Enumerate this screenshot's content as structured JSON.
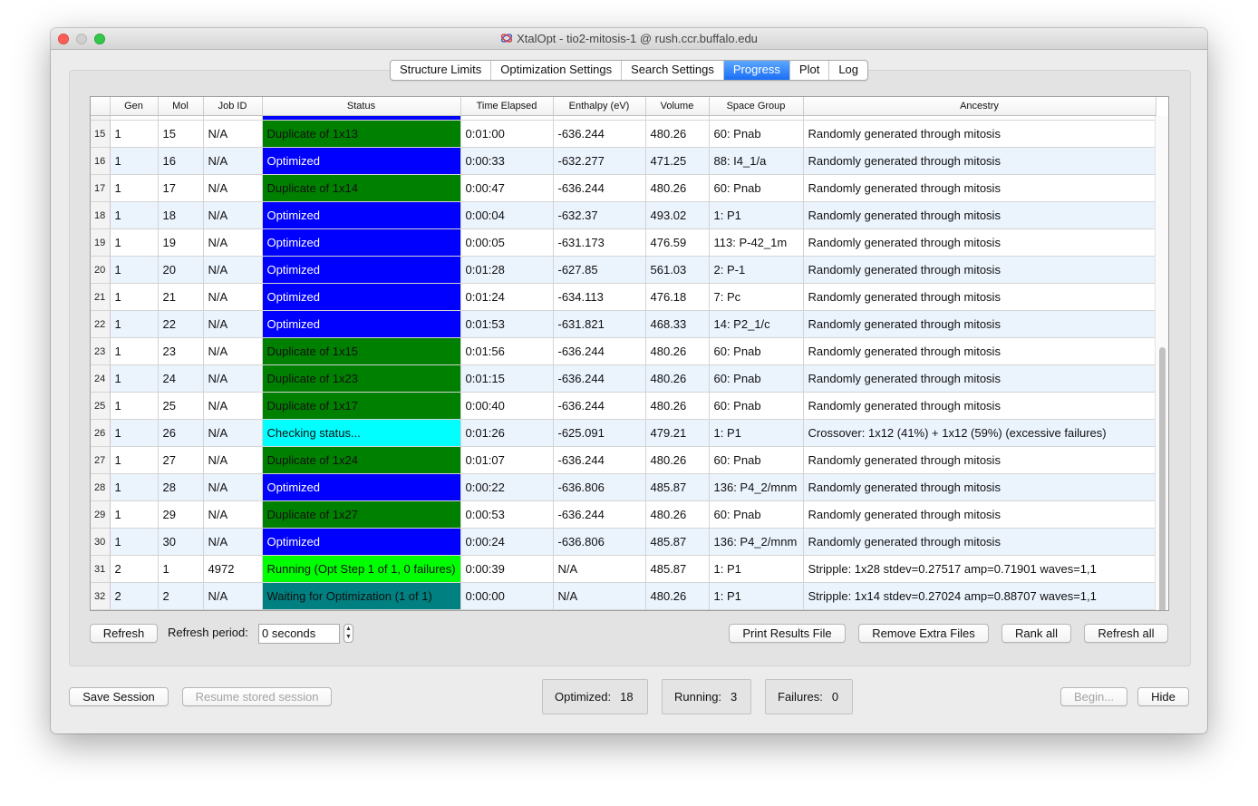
{
  "window": {
    "title": "XtalOpt - tio2-mitosis-1 @ rush.ccr.buffalo.edu"
  },
  "tabs": [
    "Structure Limits",
    "Optimization Settings",
    "Search Settings",
    "Progress",
    "Plot",
    "Log"
  ],
  "active_tab": "Progress",
  "table": {
    "columns": [
      "Gen",
      "Mol",
      "Job ID",
      "Status",
      "Time Elapsed",
      "Enthalpy (eV)",
      "Volume",
      "Space Group",
      "Ancestry"
    ],
    "status_colors": {
      "duplicate": "#008000",
      "optimized": "#0000ff",
      "checking": "#00ffff",
      "running": "#00ff00",
      "waiting": "#008080"
    },
    "rows": [
      {
        "row": "15",
        "gen": "1",
        "mol": "15",
        "job": "N/A",
        "status": "Duplicate of 1x13",
        "status_kind": "duplicate",
        "time": "0:01:00",
        "enthalpy": "-636.244",
        "volume": "480.26",
        "spacegroup": "60: Pnab",
        "ancestry": "Randomly generated through mitosis"
      },
      {
        "row": "16",
        "gen": "1",
        "mol": "16",
        "job": "N/A",
        "status": "Optimized",
        "status_kind": "optimized",
        "time": "0:00:33",
        "enthalpy": "-632.277",
        "volume": "471.25",
        "spacegroup": "88: I4_1/a",
        "ancestry": "Randomly generated through mitosis"
      },
      {
        "row": "17",
        "gen": "1",
        "mol": "17",
        "job": "N/A",
        "status": "Duplicate of 1x14",
        "status_kind": "duplicate",
        "time": "0:00:47",
        "enthalpy": "-636.244",
        "volume": "480.26",
        "spacegroup": "60: Pnab",
        "ancestry": "Randomly generated through mitosis"
      },
      {
        "row": "18",
        "gen": "1",
        "mol": "18",
        "job": "N/A",
        "status": "Optimized",
        "status_kind": "optimized",
        "time": "0:00:04",
        "enthalpy": "-632.37",
        "volume": "493.02",
        "spacegroup": "1: P1",
        "ancestry": "Randomly generated through mitosis"
      },
      {
        "row": "19",
        "gen": "1",
        "mol": "19",
        "job": "N/A",
        "status": "Optimized",
        "status_kind": "optimized",
        "time": "0:00:05",
        "enthalpy": "-631.173",
        "volume": "476.59",
        "spacegroup": "113: P-42_1m",
        "ancestry": "Randomly generated through mitosis"
      },
      {
        "row": "20",
        "gen": "1",
        "mol": "20",
        "job": "N/A",
        "status": "Optimized",
        "status_kind": "optimized",
        "time": "0:01:28",
        "enthalpy": "-627.85",
        "volume": "561.03",
        "spacegroup": "2: P-1",
        "ancestry": "Randomly generated through mitosis"
      },
      {
        "row": "21",
        "gen": "1",
        "mol": "21",
        "job": "N/A",
        "status": "Optimized",
        "status_kind": "optimized",
        "time": "0:01:24",
        "enthalpy": "-634.113",
        "volume": "476.18",
        "spacegroup": "7: Pc",
        "ancestry": "Randomly generated through mitosis"
      },
      {
        "row": "22",
        "gen": "1",
        "mol": "22",
        "job": "N/A",
        "status": "Optimized",
        "status_kind": "optimized",
        "time": "0:01:53",
        "enthalpy": "-631.821",
        "volume": "468.33",
        "spacegroup": "14: P2_1/c",
        "ancestry": "Randomly generated through mitosis"
      },
      {
        "row": "23",
        "gen": "1",
        "mol": "23",
        "job": "N/A",
        "status": "Duplicate of 1x15",
        "status_kind": "duplicate",
        "time": "0:01:56",
        "enthalpy": "-636.244",
        "volume": "480.26",
        "spacegroup": "60: Pnab",
        "ancestry": "Randomly generated through mitosis"
      },
      {
        "row": "24",
        "gen": "1",
        "mol": "24",
        "job": "N/A",
        "status": "Duplicate of 1x23",
        "status_kind": "duplicate",
        "time": "0:01:15",
        "enthalpy": "-636.244",
        "volume": "480.26",
        "spacegroup": "60: Pnab",
        "ancestry": "Randomly generated through mitosis"
      },
      {
        "row": "25",
        "gen": "1",
        "mol": "25",
        "job": "N/A",
        "status": "Duplicate of 1x17",
        "status_kind": "duplicate",
        "time": "0:00:40",
        "enthalpy": "-636.244",
        "volume": "480.26",
        "spacegroup": "60: Pnab",
        "ancestry": "Randomly generated through mitosis"
      },
      {
        "row": "26",
        "gen": "1",
        "mol": "26",
        "job": "N/A",
        "status": "Checking status...",
        "status_kind": "checking",
        "time": "0:01:26",
        "enthalpy": "-625.091",
        "volume": "479.21",
        "spacegroup": "1: P1",
        "ancestry": "Crossover: 1x12 (41%) + 1x12 (59%) (excessive failures)"
      },
      {
        "row": "27",
        "gen": "1",
        "mol": "27",
        "job": "N/A",
        "status": "Duplicate of 1x24",
        "status_kind": "duplicate",
        "time": "0:01:07",
        "enthalpy": "-636.244",
        "volume": "480.26",
        "spacegroup": "60: Pnab",
        "ancestry": "Randomly generated through mitosis"
      },
      {
        "row": "28",
        "gen": "1",
        "mol": "28",
        "job": "N/A",
        "status": "Optimized",
        "status_kind": "optimized",
        "time": "0:00:22",
        "enthalpy": "-636.806",
        "volume": "485.87",
        "spacegroup": "136: P4_2/mnm",
        "ancestry": "Randomly generated through mitosis"
      },
      {
        "row": "29",
        "gen": "1",
        "mol": "29",
        "job": "N/A",
        "status": "Duplicate of 1x27",
        "status_kind": "duplicate",
        "time": "0:00:53",
        "enthalpy": "-636.244",
        "volume": "480.26",
        "spacegroup": "60: Pnab",
        "ancestry": "Randomly generated through mitosis"
      },
      {
        "row": "30",
        "gen": "1",
        "mol": "30",
        "job": "N/A",
        "status": "Optimized",
        "status_kind": "optimized",
        "time": "0:00:24",
        "enthalpy": "-636.806",
        "volume": "485.87",
        "spacegroup": "136: P4_2/mnm",
        "ancestry": "Randomly generated through mitosis"
      },
      {
        "row": "31",
        "gen": "2",
        "mol": "1",
        "job": "4972",
        "status": "Running (Opt Step 1 of 1, 0 failures)",
        "status_kind": "running",
        "time": "0:00:39",
        "enthalpy": "N/A",
        "volume": "485.87",
        "spacegroup": "1: P1",
        "ancestry": "Stripple: 1x28 stdev=0.27517 amp=0.71901 waves=1,1"
      },
      {
        "row": "32",
        "gen": "2",
        "mol": "2",
        "job": "N/A",
        "status": "Waiting for Optimization (1 of 1)",
        "status_kind": "waiting",
        "time": "0:00:00",
        "enthalpy": "N/A",
        "volume": "480.26",
        "spacegroup": "1: P1",
        "ancestry": "Stripple: 1x14 stdev=0.27024 amp=0.88707 waves=1,1"
      }
    ]
  },
  "controls": {
    "refresh": "Refresh",
    "refresh_period_label": "Refresh period:",
    "refresh_period_value": "0 seconds",
    "print_results": "Print Results File",
    "remove_extra": "Remove Extra Files",
    "rank_all": "Rank all",
    "refresh_all": "Refresh all"
  },
  "footer": {
    "save_session": "Save Session",
    "resume_session": "Resume stored session",
    "optimized_label": "Optimized:",
    "optimized_value": "18",
    "running_label": "Running:",
    "running_value": "3",
    "failures_label": "Failures:",
    "failures_value": "0",
    "begin": "Begin...",
    "hide": "Hide"
  }
}
